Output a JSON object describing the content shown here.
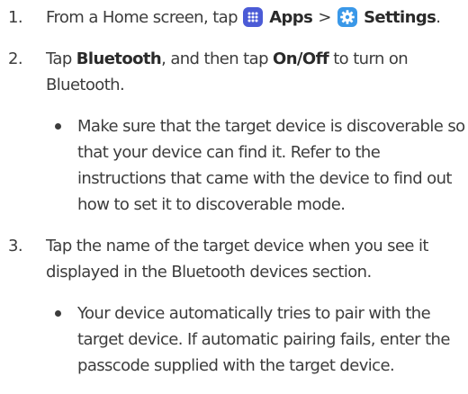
{
  "steps": [
    {
      "number": "1.",
      "text_a": "From a Home screen, tap ",
      "apps": "Apps",
      "separator": ">",
      "settings": "Settings",
      "text_end": "."
    },
    {
      "number": "2.",
      "text_a": "Tap ",
      "bluetooth": "Bluetooth",
      "text_b": ", and then tap ",
      "onoff": "On/Off",
      "text_c": " to turn on Bluetooth.",
      "bullet": "Make sure that the target device is discoverable so that your device can find it. Refer to the instructions that came with the device to find out how to set it to discoverable mode."
    },
    {
      "number": "3.",
      "text": "Tap the name of the target device when you see it displayed in the Bluetooth devices section.",
      "bullet": "Your device automatically tries to pair with the target device. If automatic pairing fails, enter the passcode supplied with the target device."
    }
  ],
  "icons": {
    "apps": "apps-grid-icon",
    "settings": "gear-icon"
  },
  "colors": {
    "apps_icon_bg": "#4b5bd6",
    "settings_icon_bg": "#3a98e8",
    "text": "#3c3c3c"
  }
}
